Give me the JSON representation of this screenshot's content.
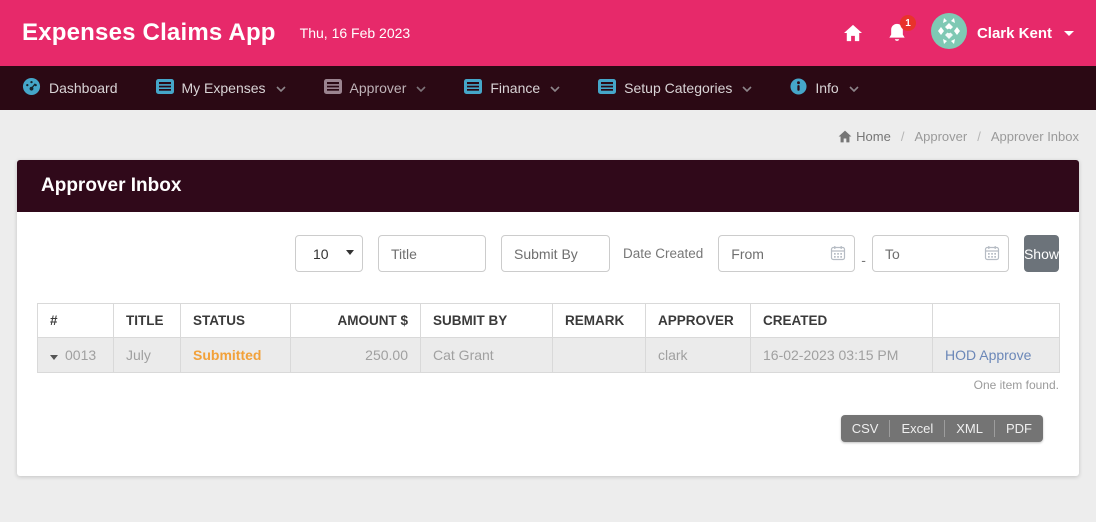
{
  "app": {
    "title": "Expenses Claims App",
    "date": "Thu, 16 Feb 2023",
    "user_name": "Clark Kent",
    "notification_count": "1",
    "icons": [
      "home-icon",
      "bell-icon",
      "avatar",
      "caret-down-icon"
    ]
  },
  "nav": {
    "items": [
      {
        "label": "Dashboard",
        "icon": "dashboard-gauge-icon"
      },
      {
        "label": "My Expenses",
        "icon": "list-icon"
      },
      {
        "label": "Approver",
        "icon": "list-icon"
      },
      {
        "label": "Finance",
        "icon": "list-icon"
      },
      {
        "label": "Setup Categories",
        "icon": "list-icon"
      },
      {
        "label": "Info",
        "icon": "info-circle-icon"
      }
    ]
  },
  "breadcrumb": {
    "separator": "/",
    "items": [
      "Home",
      "Approver",
      "Approver Inbox"
    ]
  },
  "panel": {
    "title": "Approver Inbox"
  },
  "filters": {
    "page_size": "10",
    "title_placeholder": "Title",
    "submit_by_placeholder": "Submit By",
    "date_created_label": "Date Created",
    "from_placeholder": "From",
    "to_placeholder": "To",
    "range_separator": "-",
    "show_label": "Show"
  },
  "table": {
    "columns": [
      "#",
      "TITLE",
      "STATUS",
      "AMOUNT $",
      "SUBMIT BY",
      "REMARK",
      "APPROVER",
      "CREATED",
      ""
    ],
    "rows": [
      {
        "id": "0013",
        "title": "July",
        "status": "Submitted",
        "amount": "250.00",
        "submit_by": "Cat Grant",
        "remark": "",
        "approver": "clark",
        "created": "16-02-2023 03:15 PM",
        "action": "HOD Approve"
      }
    ],
    "summary": "One item found."
  },
  "export": {
    "buttons": [
      "CSV",
      "Excel",
      "XML",
      "PDF"
    ]
  },
  "colors": {
    "header_pink": "#e7296a",
    "nav_dark": "#2b0914",
    "panel_header_dark": "#30091a",
    "icon_teal": "#45a6c9",
    "status_orange": "#f2a13a",
    "link_blue": "#6b87b8",
    "show_button_gray": "#6c737a",
    "badge_red": "#e8332b",
    "avatar_teal": "#7fc9b4"
  }
}
